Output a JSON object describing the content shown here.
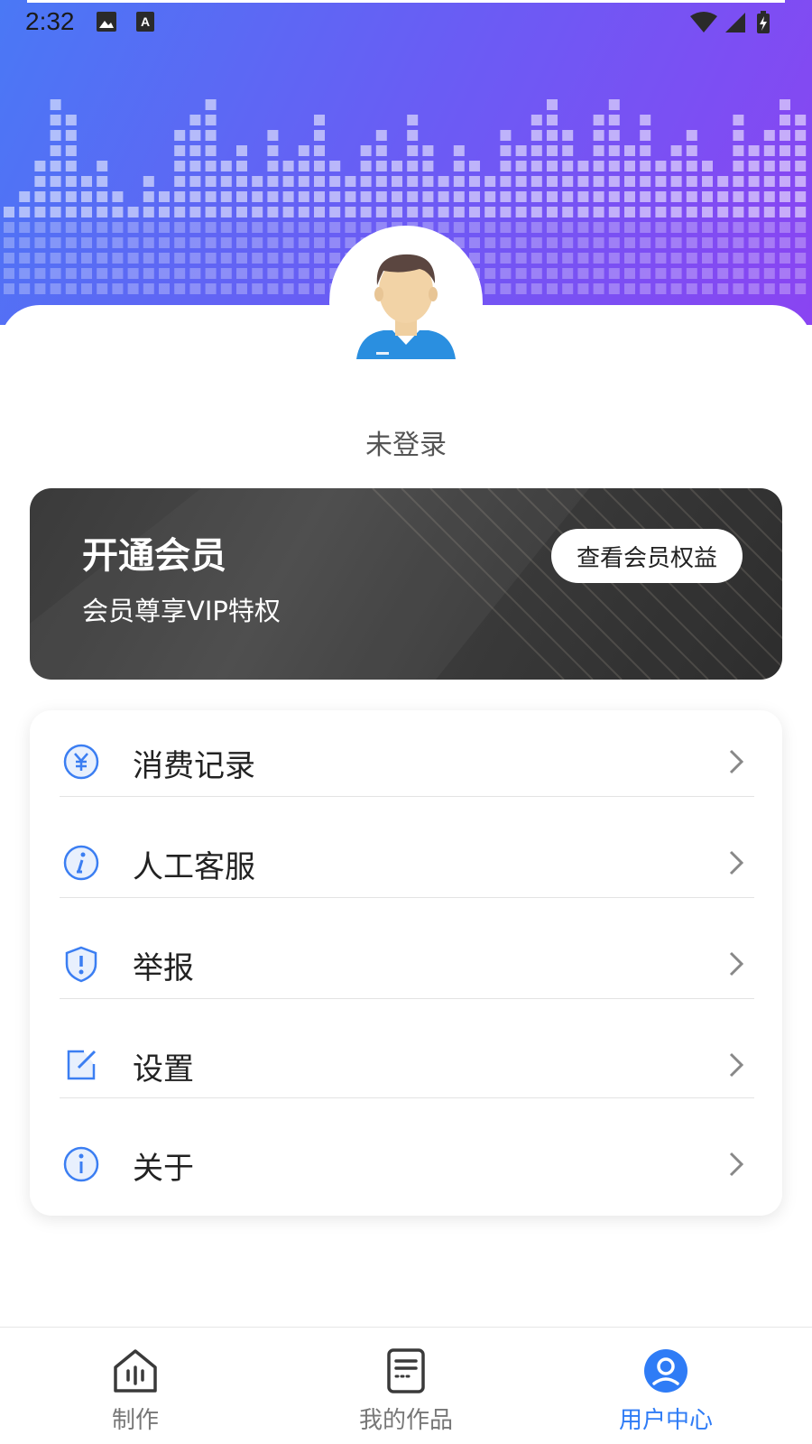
{
  "status_bar": {
    "time": "2:32"
  },
  "profile": {
    "login_status": "未登录"
  },
  "vip": {
    "title": "开通会员",
    "subtitle": "会员尊享VIP特权",
    "button_label": "查看会员权益"
  },
  "menu": {
    "items": [
      {
        "label": "消费记录",
        "icon": "yuan-icon"
      },
      {
        "label": "人工客服",
        "icon": "info-italic-icon"
      },
      {
        "label": "举报",
        "icon": "shield-alert-icon"
      },
      {
        "label": "设置",
        "icon": "edit-square-icon"
      },
      {
        "label": "关于",
        "icon": "info-icon"
      }
    ]
  },
  "bottom_nav": {
    "items": [
      {
        "label": "制作",
        "icon": "studio-icon",
        "active": false
      },
      {
        "label": "我的作品",
        "icon": "document-icon",
        "active": false
      },
      {
        "label": "用户中心",
        "icon": "user-circle-icon",
        "active": true
      }
    ]
  },
  "colors": {
    "accent": "#2f7cf6",
    "header_gradient_start": "#4a78f5",
    "header_gradient_end": "#8a44f2",
    "vip_background": "#3c3c3c"
  }
}
